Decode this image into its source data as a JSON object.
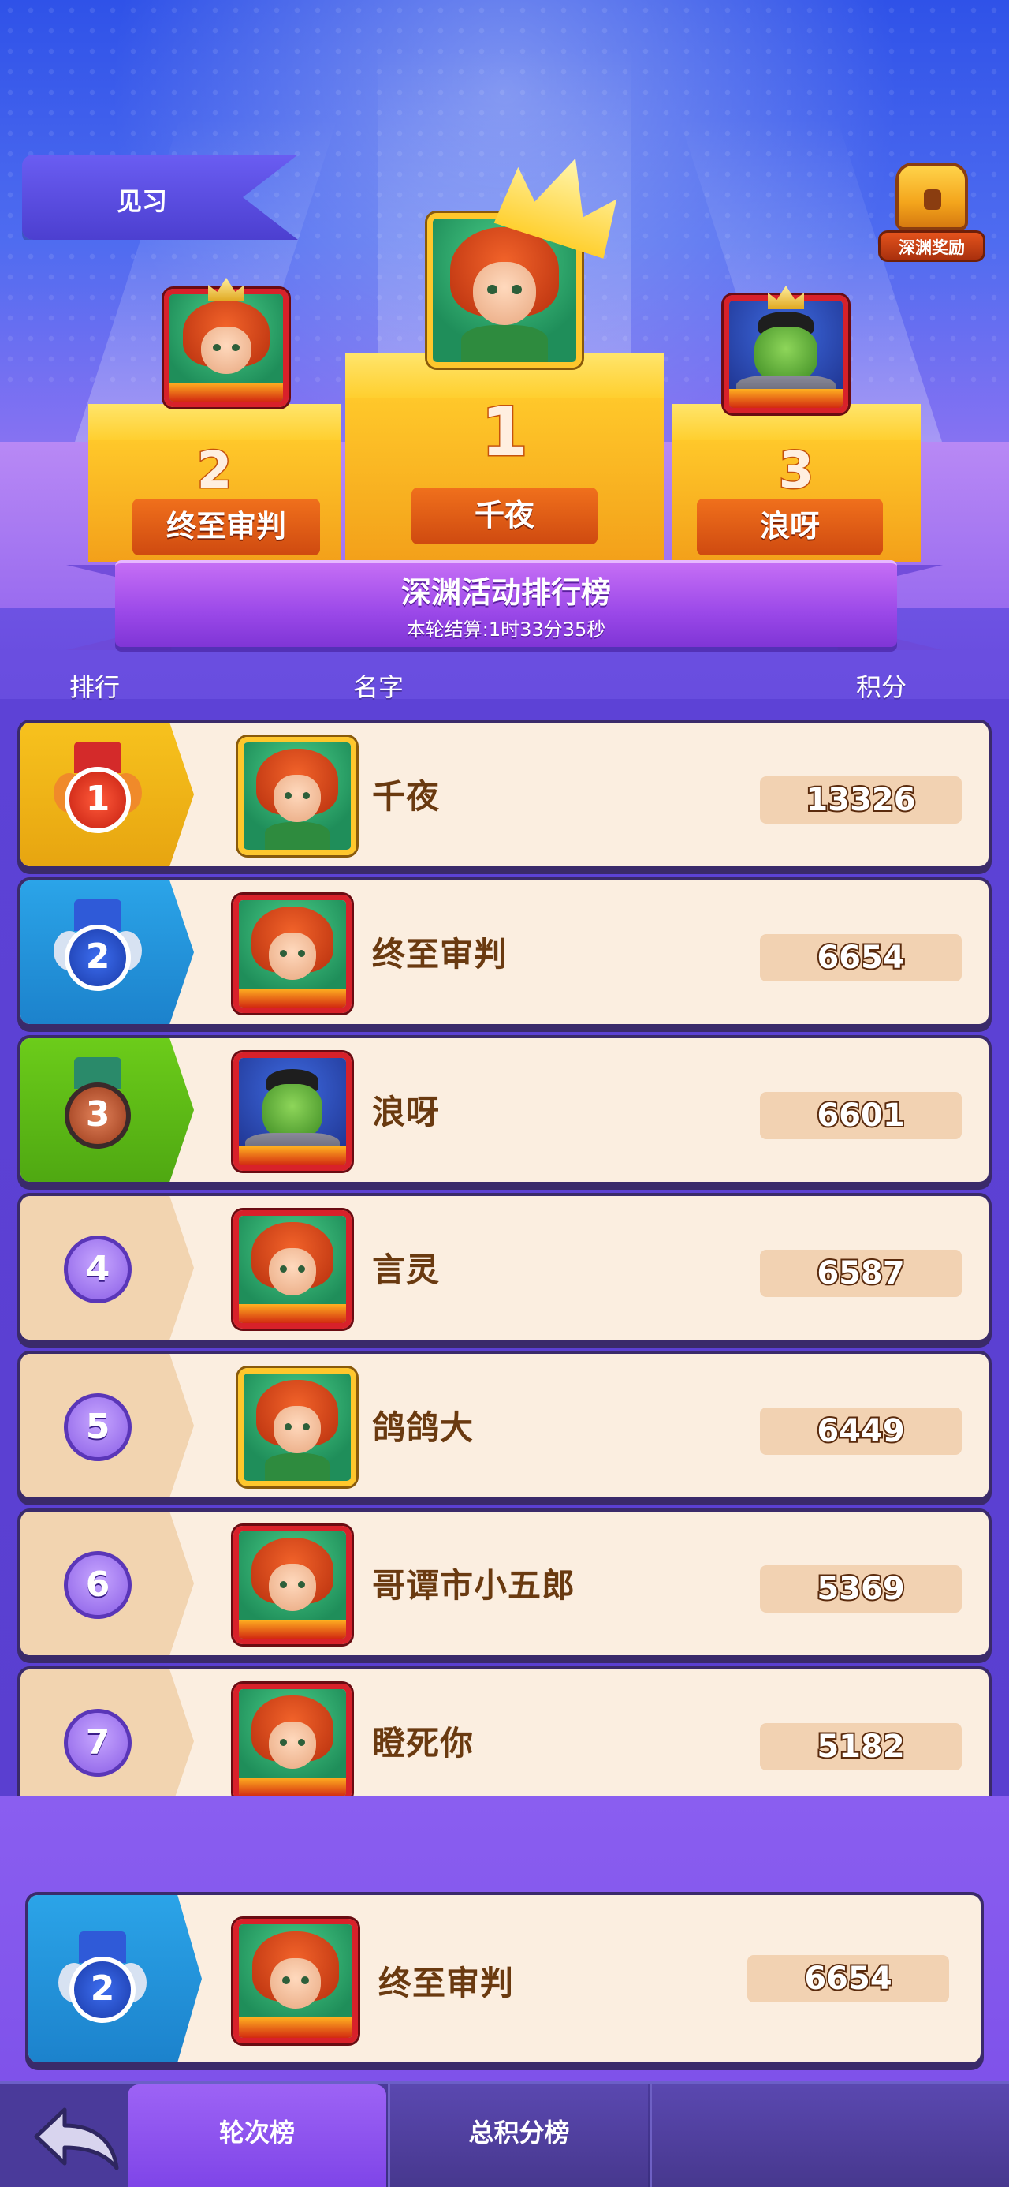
{
  "header": {
    "rank_tier": "见习",
    "reward_label": "深渊奖励"
  },
  "podium": [
    {
      "rank": "2",
      "name": "终至审判"
    },
    {
      "rank": "1",
      "name": "千夜"
    },
    {
      "rank": "3",
      "name": "浪呀"
    }
  ],
  "banner": {
    "title": "深渊活动排行榜",
    "countdown": "本轮结算:1时33分35秒"
  },
  "columns": {
    "rank": "排行",
    "name": "名字",
    "score": "积分"
  },
  "leaderboard": [
    {
      "rank": "1",
      "name": "千夜",
      "score": "13326",
      "avatar": "elf-girl-gold"
    },
    {
      "rank": "2",
      "name": "终至审判",
      "score": "6654",
      "avatar": "elf-girl-red"
    },
    {
      "rank": "3",
      "name": "浪呀",
      "score": "6601",
      "avatar": "orc-red"
    },
    {
      "rank": "4",
      "name": "言灵",
      "score": "6587",
      "avatar": "elf-girl-red"
    },
    {
      "rank": "5",
      "name": "鸽鸽大",
      "score": "6449",
      "avatar": "elf-girl-gold"
    },
    {
      "rank": "6",
      "name": "哥谭市小五郎",
      "score": "5369",
      "avatar": "elf-girl-red"
    },
    {
      "rank": "7",
      "name": "瞪死你",
      "score": "5182",
      "avatar": "elf-girl-red"
    }
  ],
  "self": {
    "rank": "2",
    "name": "终至审判",
    "score": "6654"
  },
  "tabs": [
    {
      "label": "轮次榜",
      "active": true
    },
    {
      "label": "总积分榜",
      "active": false
    }
  ],
  "colors": {
    "gold": "#f7c21e",
    "silver_blue": "#2ba4e8",
    "bronze_green": "#6ccc1a",
    "row_bg": "#fbeee0",
    "name_text": "#6a3a10"
  }
}
